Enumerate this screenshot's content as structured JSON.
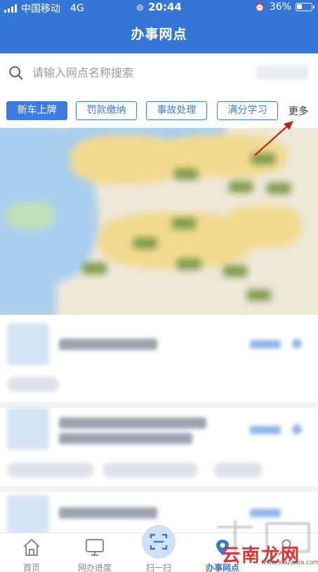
{
  "status_bar": {
    "carrier": "中国移动",
    "network": "4G",
    "time": "20:44",
    "battery": "36%"
  },
  "header": {
    "title": "办事网点"
  },
  "search": {
    "placeholder": "请输入网点名称搜索"
  },
  "filters": {
    "chips": [
      "新车上牌",
      "罚款缴纳",
      "事故处理",
      "满分学习"
    ],
    "more_label": "更多"
  },
  "colors": {
    "brand_blue": "#3476d8",
    "chip_blue": "#3c7be0",
    "annotation_arrow": "#c0261f"
  },
  "nav": {
    "items": [
      {
        "label": "首页",
        "icon": "home-icon"
      },
      {
        "label": "网办进度",
        "icon": "monitor-icon"
      },
      {
        "label": "扫一扫",
        "icon": "scan-icon"
      },
      {
        "label": "办事网点",
        "icon": "location-icon"
      },
      {
        "label": "",
        "icon": "user-icon"
      }
    ],
    "active_index": 3
  },
  "watermark": {
    "text": "云南龙网",
    "sub": "www.xiazaiba.com"
  }
}
